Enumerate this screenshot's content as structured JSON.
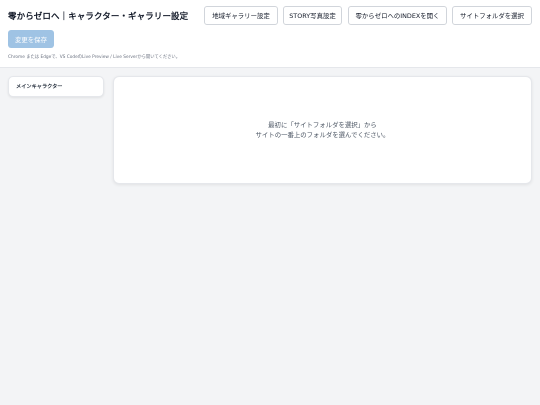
{
  "header": {
    "title": "零からゼロへ｜キャラクター・ギャラリー設定",
    "buttons": {
      "region_gallery": "地域ギャラリー設定",
      "story_photo": "STORY写真設定",
      "open_index": "零からゼロへのINDEXを開く",
      "select_site_folder": "サイトフォルダを選択"
    },
    "save_label": "変更を保存",
    "hint": "Chrome または Edgeで、VS CodeのLive Preview / Live Serverから開いてください。"
  },
  "sidebar": {
    "items": [
      {
        "label": "メインキャラクター"
      }
    ]
  },
  "main": {
    "empty_line1": "最初に「サイトフォルダを選択」から",
    "empty_line2": "サイトの一番上のフォルダを選んでください。"
  },
  "colors": {
    "save_button_bg": "#9fc3e4",
    "page_bg": "#f3f4f6",
    "panel_bg": "#ffffff"
  }
}
